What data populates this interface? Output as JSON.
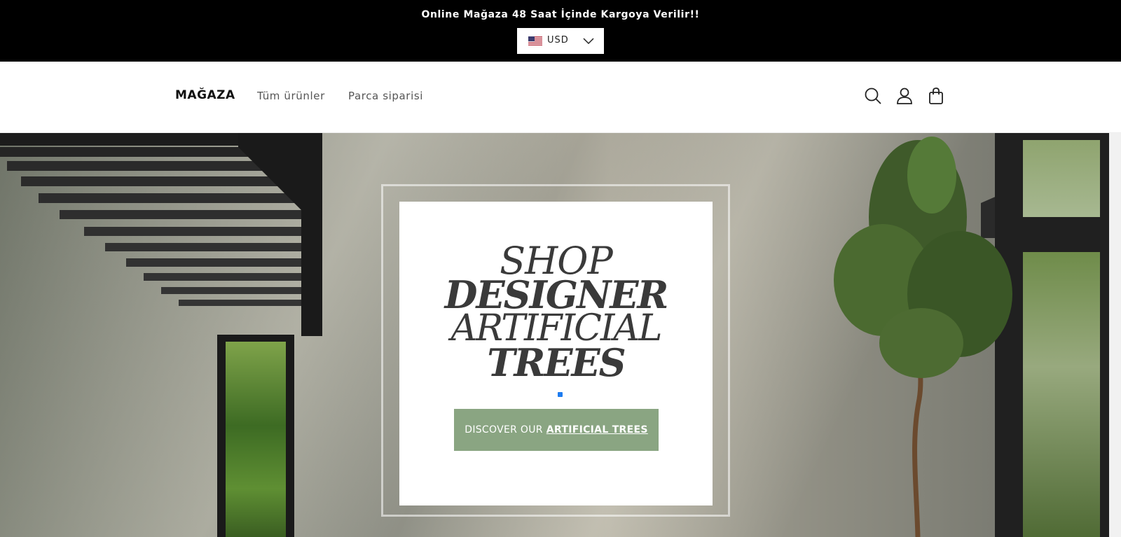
{
  "announcement": {
    "text": "Online Mağaza 48 Saat İçinde Kargoya Verilir!!"
  },
  "currency": {
    "code": "USD",
    "flag": "us-flag-icon"
  },
  "header": {
    "logo": "MAĞAZA",
    "nav": [
      {
        "label": "Tüm ürünler"
      },
      {
        "label": "Parca siparisi"
      }
    ],
    "icons": [
      "search-icon",
      "account-icon",
      "cart-icon"
    ]
  },
  "hero": {
    "headline": [
      "SHOP",
      "DESIGNER",
      "ARTIFICIAL",
      "TREES"
    ],
    "cta_prefix": "DISCOVER OUR",
    "cta_emphasis": "ARTIFICIAL TREES",
    "slide_count": 1,
    "active_slide": 1
  },
  "colors": {
    "announcement_bg": "#000000",
    "cta_bg": "#8aa582",
    "slider_dot": "#1e7cf0"
  }
}
